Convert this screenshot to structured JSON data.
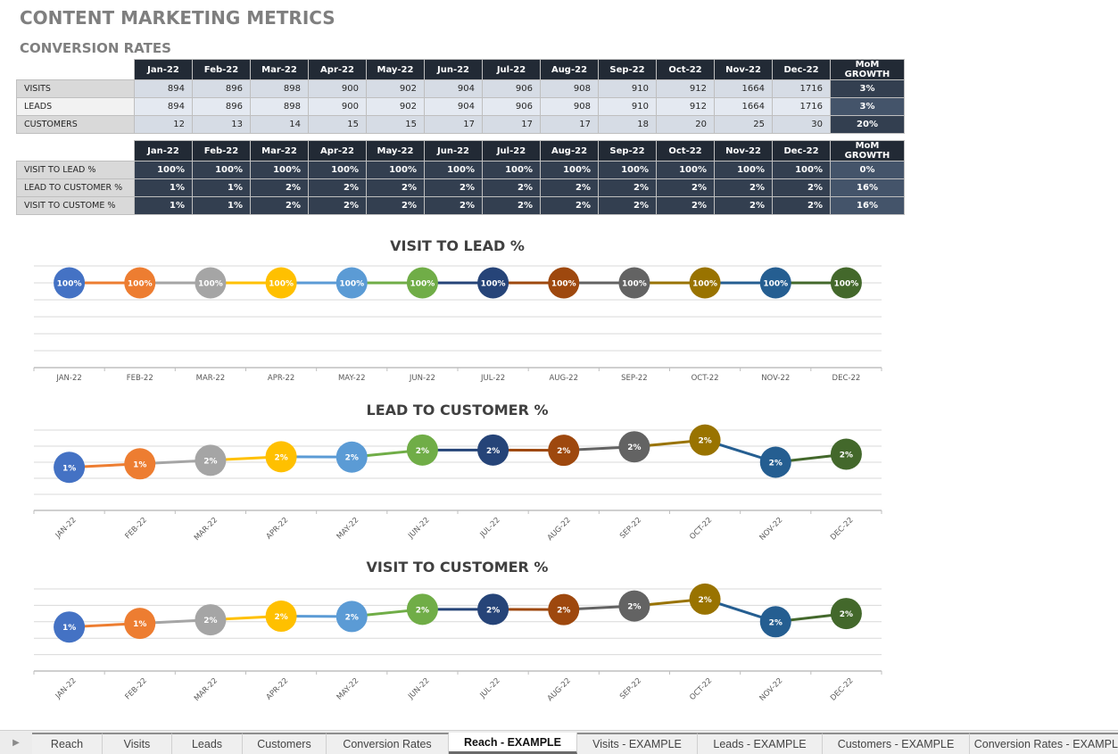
{
  "page": {
    "title": "CONTENT MARKETING METRICS",
    "section_title": "CONVERSION RATES"
  },
  "table1": {
    "headers": [
      "Jan-22",
      "Feb-22",
      "Mar-22",
      "Apr-22",
      "May-22",
      "Jun-22",
      "Jul-22",
      "Aug-22",
      "Sep-22",
      "Oct-22",
      "Nov-22",
      "Dec-22"
    ],
    "growth_header": "MoM GROWTH",
    "rows": [
      {
        "label": "VISITS",
        "values": [
          "894",
          "896",
          "898",
          "900",
          "902",
          "904",
          "906",
          "908",
          "910",
          "912",
          "1664",
          "1716"
        ],
        "growth": "3%"
      },
      {
        "label": "LEADS",
        "values": [
          "894",
          "896",
          "898",
          "900",
          "902",
          "904",
          "906",
          "908",
          "910",
          "912",
          "1664",
          "1716"
        ],
        "growth": "3%"
      },
      {
        "label": "CUSTOMERS",
        "values": [
          "12",
          "13",
          "14",
          "15",
          "15",
          "17",
          "17",
          "17",
          "18",
          "20",
          "25",
          "30"
        ],
        "growth": "20%"
      }
    ]
  },
  "table2": {
    "headers": [
      "Jan-22",
      "Feb-22",
      "Mar-22",
      "Apr-22",
      "May-22",
      "Jun-22",
      "Jul-22",
      "Aug-22",
      "Sep-22",
      "Oct-22",
      "Nov-22",
      "Dec-22"
    ],
    "growth_header": "MoM GROWTH",
    "rows": [
      {
        "label": "VISIT TO LEAD %",
        "values": [
          "100%",
          "100%",
          "100%",
          "100%",
          "100%",
          "100%",
          "100%",
          "100%",
          "100%",
          "100%",
          "100%",
          "100%"
        ],
        "growth": "0%"
      },
      {
        "label": "LEAD TO CUSTOMER %",
        "values": [
          "1%",
          "1%",
          "2%",
          "2%",
          "2%",
          "2%",
          "2%",
          "2%",
          "2%",
          "2%",
          "2%",
          "2%"
        ],
        "growth": "16%"
      },
      {
        "label": "VISIT TO CUSTOME %",
        "values": [
          "1%",
          "1%",
          "2%",
          "2%",
          "2%",
          "2%",
          "2%",
          "2%",
          "2%",
          "2%",
          "2%",
          "2%"
        ],
        "growth": "16%"
      }
    ]
  },
  "chart_data": [
    {
      "type": "line",
      "title": "VISIT TO LEAD %",
      "categories": [
        "JAN-22",
        "FEB-22",
        "MAR-22",
        "APR-22",
        "MAY-22",
        "JUN-22",
        "JUL-22",
        "AUG-22",
        "SEP-22",
        "OCT-22",
        "NOV-22",
        "DEC-22"
      ],
      "values": [
        100,
        100,
        100,
        100,
        100,
        100,
        100,
        100,
        100,
        100,
        100,
        100
      ],
      "data_labels": [
        "100%",
        "100%",
        "100%",
        "100%",
        "100%",
        "100%",
        "100%",
        "100%",
        "100%",
        "100%",
        "100%",
        "100%"
      ],
      "ylim": [
        0,
        120
      ],
      "grid_step": 20,
      "grid": true,
      "xlabel_rotation": 0,
      "xlabel": "",
      "ylabel": ""
    },
    {
      "type": "line",
      "title": "LEAD TO CUSTOMER %",
      "categories": [
        "JAN-22",
        "FEB-22",
        "MAR-22",
        "APR-22",
        "MAY-22",
        "JUN-22",
        "JUL-22",
        "AUG-22",
        "SEP-22",
        "OCT-22",
        "NOV-22",
        "DEC-22"
      ],
      "values": [
        1.34,
        1.45,
        1.56,
        1.67,
        1.66,
        1.88,
        1.88,
        1.87,
        1.98,
        2.19,
        1.5,
        1.75
      ],
      "data_labels": [
        "1%",
        "1%",
        "2%",
        "2%",
        "2%",
        "2%",
        "2%",
        "2%",
        "2%",
        "2%",
        "2%",
        "2%"
      ],
      "ylim": [
        0,
        2.5
      ],
      "grid_step": 0.5,
      "grid": true,
      "xlabel_rotation": -45,
      "xlabel": "",
      "ylabel": ""
    },
    {
      "type": "line",
      "title": "VISIT TO CUSTOMER %",
      "categories": [
        "JAN-22",
        "FEB-22",
        "MAR-22",
        "APR-22",
        "MAY-22",
        "JUN-22",
        "JUL-22",
        "AUG-22",
        "SEP-22",
        "OCT-22",
        "NOV-22",
        "DEC-22"
      ],
      "values": [
        1.34,
        1.45,
        1.56,
        1.67,
        1.66,
        1.88,
        1.88,
        1.87,
        1.98,
        2.19,
        1.5,
        1.75
      ],
      "data_labels": [
        "1%",
        "1%",
        "2%",
        "2%",
        "2%",
        "2%",
        "2%",
        "2%",
        "2%",
        "2%",
        "2%",
        "2%"
      ],
      "ylim": [
        0,
        2.5
      ],
      "grid_step": 0.5,
      "grid": true,
      "xlabel_rotation": -45,
      "xlabel": "",
      "ylabel": ""
    }
  ],
  "marker_colors": [
    "#4472c4",
    "#ed7d31",
    "#a5a5a5",
    "#ffc000",
    "#5b9bd5",
    "#70ad47",
    "#264478",
    "#9e480e",
    "#636363",
    "#997300",
    "#255e91",
    "#43682b"
  ],
  "tabs": [
    {
      "label": "Reach",
      "active": false
    },
    {
      "label": "Visits",
      "active": false
    },
    {
      "label": "Leads",
      "active": false
    },
    {
      "label": "Customers",
      "active": false
    },
    {
      "label": "Conversion Rates",
      "active": false
    },
    {
      "label": "Reach - EXAMPLE",
      "active": true
    },
    {
      "label": "Visits - EXAMPLE",
      "active": false
    },
    {
      "label": "Leads - EXAMPLE",
      "active": false
    },
    {
      "label": "Customers - EXAMPLE",
      "active": false
    },
    {
      "label": "Conversion Rates - EXAMPLE",
      "active": false
    }
  ],
  "tab_nav_icon": "play-right-icon"
}
